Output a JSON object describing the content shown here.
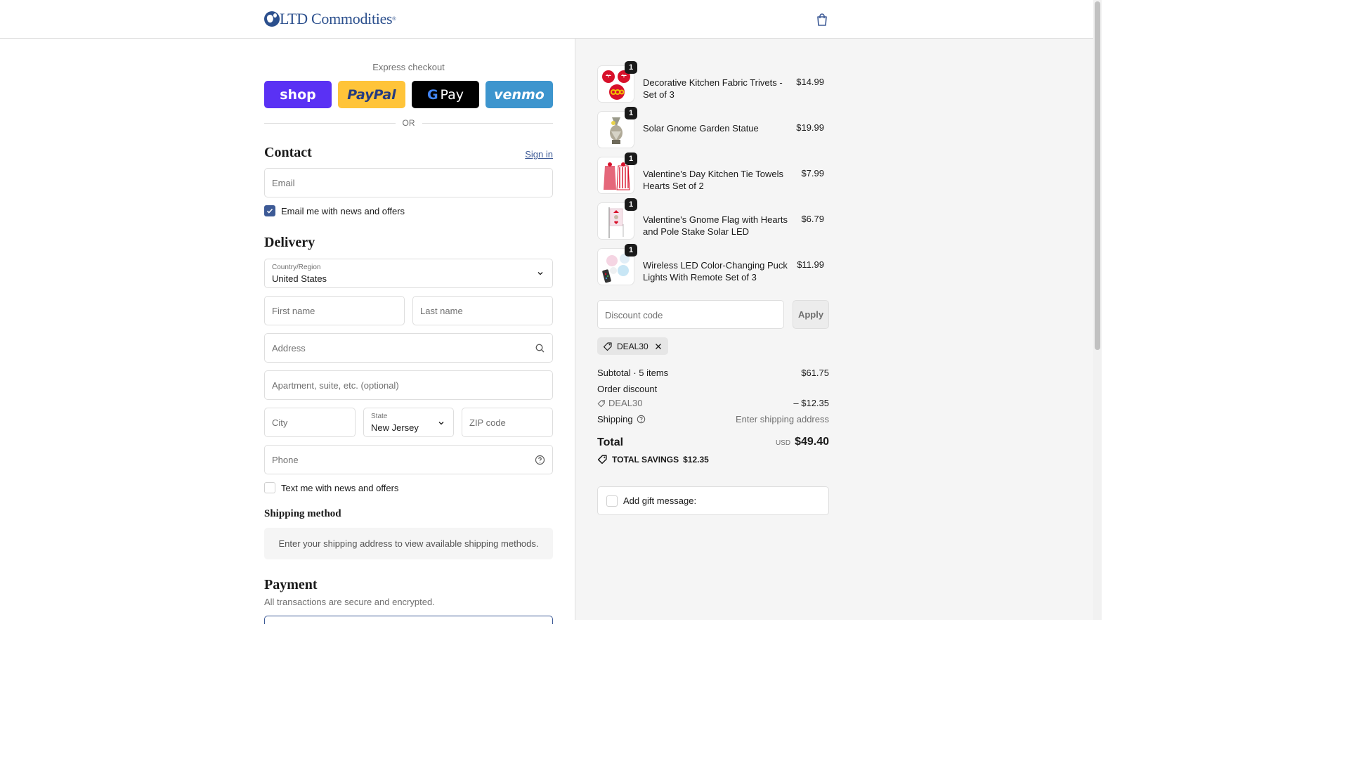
{
  "header": {
    "brand": "LTD Commodities",
    "reg_mark": "®"
  },
  "express": {
    "title": "Express checkout",
    "buttons": {
      "shop": "shop",
      "paypal": "PayPal",
      "gpay_g": "G",
      "gpay": "Pay",
      "venmo": "venmo"
    },
    "or": "OR"
  },
  "contact": {
    "title": "Contact",
    "sign_in": "Sign in",
    "email_placeholder": "Email",
    "news_label": "Email me with news and offers",
    "news_checked": true
  },
  "delivery": {
    "title": "Delivery",
    "country_label": "Country/Region",
    "country_value": "United States",
    "first_name": "First name",
    "last_name": "Last name",
    "address": "Address",
    "apartment": "Apartment, suite, etc. (optional)",
    "city": "City",
    "state_label": "State",
    "state_value": "New Jersey",
    "zip": "ZIP code",
    "phone": "Phone",
    "text_label": "Text me with news and offers",
    "text_checked": false
  },
  "shipping": {
    "title": "Shipping method",
    "note": "Enter your shipping address to view available shipping methods."
  },
  "payment": {
    "title": "Payment",
    "note": "All transactions are secure and encrypted."
  },
  "summary": {
    "items": [
      {
        "name": "Decorative Kitchen Fabric Trivets - Set of 3",
        "price": "$14.99",
        "qty": "1",
        "icon": "trivets-thumbnail"
      },
      {
        "name": "Solar Gnome Garden Statue",
        "price": "$19.99",
        "qty": "1",
        "icon": "gnome-statue-thumbnail"
      },
      {
        "name": "Valentine's Day Kitchen Tie Towels Hearts Set of 2",
        "price": "$7.99",
        "qty": "1",
        "icon": "towels-thumbnail"
      },
      {
        "name": "Valentine's Gnome Flag with Hearts and Pole Stake Solar LED",
        "price": "$6.79",
        "qty": "1",
        "icon": "gnome-flag-thumbnail"
      },
      {
        "name": "Wireless LED Color-Changing Puck Lights With Remote Set of 3",
        "price": "$11.99",
        "qty": "1",
        "icon": "puck-lights-thumbnail"
      }
    ],
    "discount_placeholder": "Discount code",
    "apply": "Apply",
    "applied_code": "DEAL30",
    "subtotal_label": "Subtotal · 5 items",
    "subtotal": "$61.75",
    "order_discount_label": "Order discount",
    "discount_code": "DEAL30",
    "discount_amount": "– $12.35",
    "shipping_label": "Shipping",
    "shipping_value": "Enter shipping address",
    "total_label": "Total",
    "currency": "USD",
    "total": "$49.40",
    "savings_label": "TOTAL SAVINGS",
    "savings": "$12.35",
    "gift_label": "Add gift message:"
  },
  "colors": {
    "accent": "#3d5a96",
    "shop": "#5a31f4",
    "paypal": "#ffc439",
    "venmo": "#3d95ce",
    "brand": "#2b4f8d"
  }
}
